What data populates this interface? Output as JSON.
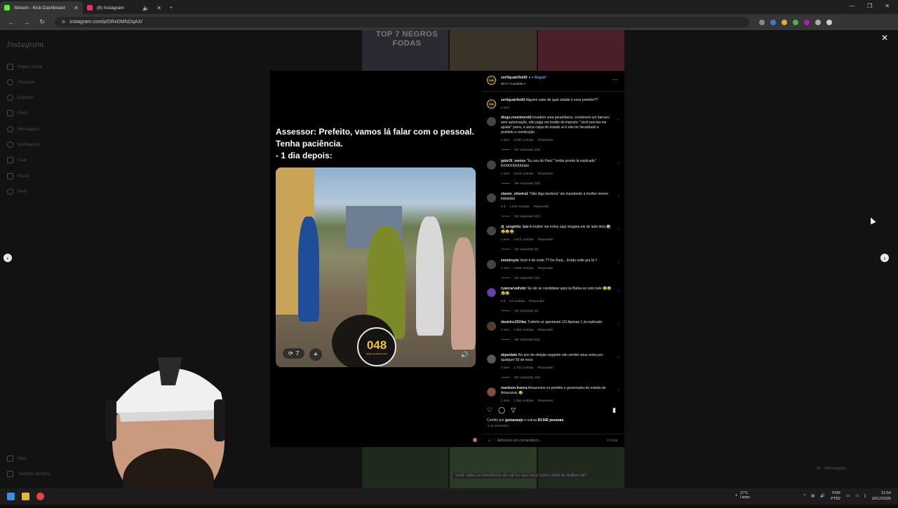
{
  "browser": {
    "tabs": [
      {
        "label": "Stream - Kick Dashboard",
        "active": true,
        "color": "#53fc18"
      },
      {
        "label": "(8) Instagram",
        "active": false,
        "color": "#e1306c"
      }
    ],
    "url": "instagram.com/p/DRxDMfsDqAX/"
  },
  "sidebar": {
    "logo": "Instagram",
    "items": [
      {
        "label": "Página inicial"
      },
      {
        "label": "Pesquisa"
      },
      {
        "label": "Explorar"
      },
      {
        "label": "Reels"
      },
      {
        "label": "Mensagens"
      },
      {
        "label": "Notificações"
      },
      {
        "label": "Criar"
      },
      {
        "label": "Painel"
      },
      {
        "label": "Perfil"
      }
    ],
    "more": "Mais",
    "also_meta": "Também da Meta"
  },
  "background": {
    "top_text": "TOP 7 NEGROS FODAS",
    "bottom_caption_1": "você saiba os benefícios do sal no seu corpo",
    "bottom_caption_2": "como você tá mulher né?"
  },
  "post": {
    "caption_lines": [
      "Assessor: Prefeito, vamos lá falar com o pessoal.",
      "Tenha paciência.",
      " - 1 dia depois:"
    ],
    "badge_number": "048",
    "badge_sub": "ZERO QUATRO OITO",
    "repost_count": "7"
  },
  "header": {
    "username": "zer0quatr0oit0",
    "follow": "Seguir",
    "sub": "DFS • Comédia !!",
    "avatar": "048"
  },
  "comments": [
    {
      "user": "zer0quatr0oit0",
      "text": "Alguém sabe de qual cidade é esse prefeito??",
      "meta": [
        "2 sem"
      ],
      "replies": ""
    },
    {
      "user": "diego.rossimorettl",
      "text": "Invadem uma perambeira, constroem um barraco sem autorização, não paga um tostão de imposto: \"você precisa me ajudar\" porra, a única culpa do estado aí é não ter fiscalizado e proibido a construção",
      "meta": [
        "1 sem",
        "5.090 curtidas",
        "Responder"
      ],
      "replies": "Ver respostas (59)"
    },
    {
      "user": "gabri3l_santos",
      "text": "\"Eu sou do Pará\" \"então pronto tá explicado\" KKKKKKKKKkkkk",
      "meta": [
        "1 sem",
        "8.646 curtidas",
        "Responder"
      ],
      "replies": "Ver respostas (30)"
    },
    {
      "user": "elanne_oliveira1",
      "text": "\"Não diga besteira\" ele mandando a mulher morrer kkkkkkkk",
      "meta": [
        "6 d",
        "1.620 curtidas",
        "Responder"
      ],
      "replies": "Ver respostas (12)"
    },
    {
      "user": "dj_serginho_luiz",
      "text": "A mulher me irritou aqui imagina ele do lado dela 😂😂😂😂",
      "meta": [
        "1 sem",
        "2.514 curtidas",
        "Responder"
      ],
      "replies": "Ver respostas (8)"
    },
    {
      "user": "emiotruyts",
      "text": "Você é de onde ?? Do Pará... Então volte pra lá !!",
      "meta": [
        "2 sem",
        "3.855 curtidas",
        "Responder"
      ],
      "replies": "Ver respostas (11)"
    },
    {
      "user": "ryancarvalhobr",
      "text": "Se ele se candidatar aqui na Bahia eu voto nele 😂😂😂😂",
      "meta": [
        "6 d",
        "15 curtidas",
        "Responder"
      ],
      "replies": "Ver respostas (2)"
    },
    {
      "user": "danielec2024ac",
      "text": "Tudinho aí apertaram 13! Apenas 1 tá explicado",
      "meta": [
        "1 sem",
        "2.654 curtidas",
        "Responder"
      ],
      "replies": "Ver respostas (62)"
    },
    {
      "user": "alqandain",
      "text": "No ano de eleição seguinte vão vender seus votos por qualquer 50 de novo",
      "meta": [
        "2 sem",
        "2.702 curtidas",
        "Responder"
      ],
      "replies": "Ver respostas (23)"
    },
    {
      "user": "mardson.franca",
      "text": "Amazonino ex prefeito e governador do estado do Amazonas 😂",
      "meta": [
        "1 sem",
        "1.064 curtidas",
        "Responder"
      ],
      "replies": ""
    }
  ],
  "footer": {
    "liked_prefix": "Curtido por",
    "liked_user": "guioaraujo",
    "liked_suffix": "e outras",
    "liked_count": "83.042 pessoas",
    "date": "2 de dezembro",
    "add_comment_placeholder": "Adicione um comentário...",
    "post_label": "Postar"
  },
  "messages_btn": "Mensagens",
  "taskbar": {
    "weather_temp": "27°C",
    "weather_desc": "Limpo",
    "lang": "POR",
    "lang2": "PTB2",
    "time": "21:54",
    "date": "16/12/2025"
  },
  "colors": {
    "accent_blue": "#4aa3ff",
    "badge_yellow": "#f2c230"
  }
}
